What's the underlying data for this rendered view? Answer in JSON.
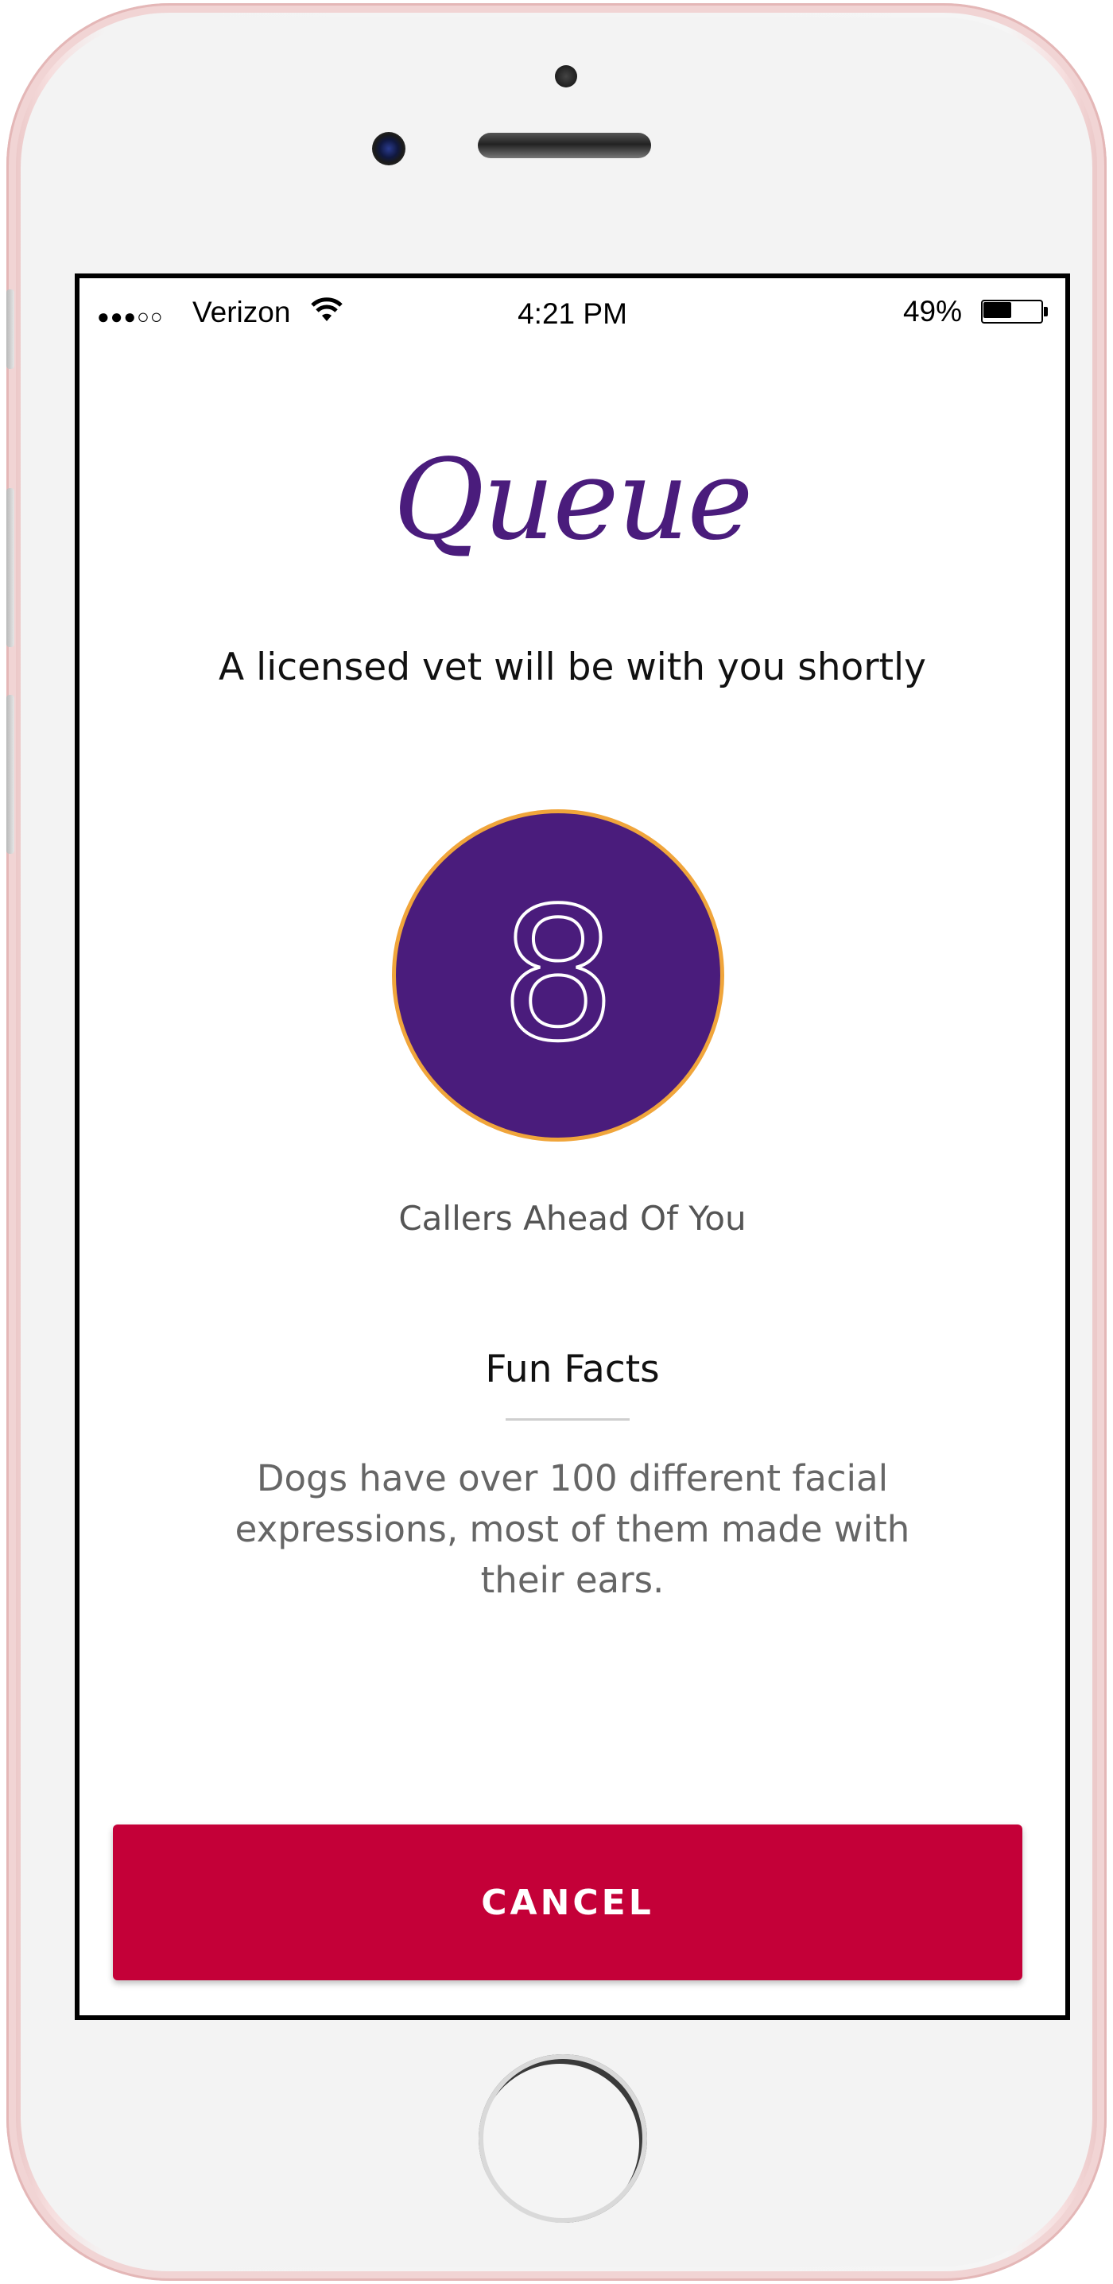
{
  "status_bar": {
    "signal": "●●●○○",
    "carrier": "Verizon",
    "time": "4:21 PM",
    "battery_percent": "49%",
    "battery_level": 0.49
  },
  "header": {
    "logo_text": "Queue",
    "subtitle": "A licensed vet will be with you shortly"
  },
  "queue": {
    "callers_ahead": "8",
    "label": "Callers Ahead Of You"
  },
  "fun_facts": {
    "title": "Fun Facts",
    "text": "Dogs have over 100 different facial expressions, most of them made with their ears."
  },
  "actions": {
    "cancel_label": "CANCEL"
  },
  "colors": {
    "brand_purple": "#4a1c7c",
    "circle_border": "#f0a53b",
    "cancel_red": "#c40038"
  }
}
